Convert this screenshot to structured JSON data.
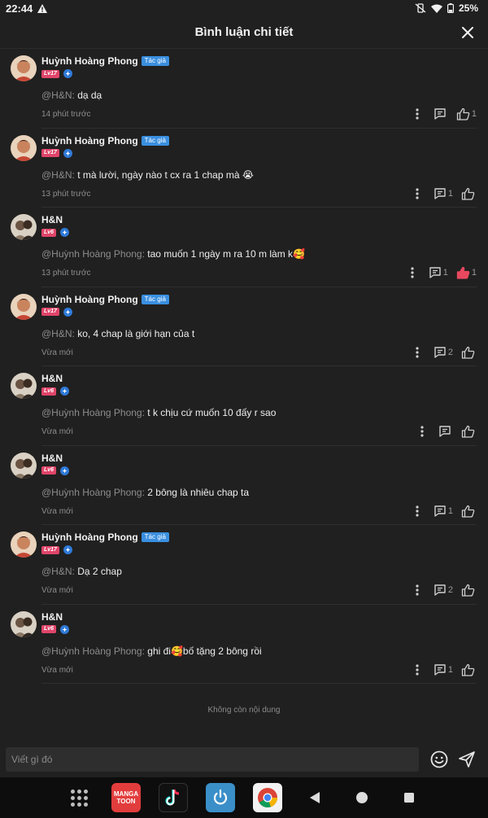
{
  "status_bar": {
    "time": "22:44",
    "battery": "25%"
  },
  "header": {
    "title": "Bình luận chi tiết"
  },
  "comments": [
    {
      "user": "Huỳnh Hoàng Phong",
      "is_author": true,
      "author_badge": "Tác giả",
      "level": "Lv17",
      "mention": "@H&N:",
      "body": "dạ dạ",
      "time": "14 phút trước",
      "reply_count": "",
      "like_count": "1",
      "liked": false
    },
    {
      "user": "Huỳnh Hoàng Phong",
      "is_author": true,
      "author_badge": "Tác giả",
      "level": "Lv17",
      "mention": "@H&N:",
      "body": "t mà lười, ngày nào t cx ra 1 chap mà 😭",
      "time": "13 phút trước",
      "reply_count": "1",
      "like_count": "",
      "liked": false
    },
    {
      "user": "H&N",
      "is_author": false,
      "author_badge": "",
      "level": "Lv6",
      "mention": "@Huỳnh Hoàng Phong:",
      "body": "tao muốn 1 ngày m ra 10 m làm k🥰",
      "time": "13 phút trước",
      "reply_count": "1",
      "like_count": "1",
      "liked": true
    },
    {
      "user": "Huỳnh Hoàng Phong",
      "is_author": true,
      "author_badge": "Tác giả",
      "level": "Lv17",
      "mention": "@H&N:",
      "body": "ko, 4 chap là giới hạn của t",
      "time": "Vừa mới",
      "reply_count": "2",
      "like_count": "",
      "liked": false
    },
    {
      "user": "H&N",
      "is_author": false,
      "author_badge": "",
      "level": "Lv6",
      "mention": "@Huỳnh Hoàng Phong:",
      "body": "t k chịu cứ muốn 10 đấy r sao",
      "time": "Vừa mới",
      "reply_count": "",
      "like_count": "",
      "liked": false
    },
    {
      "user": "H&N",
      "is_author": false,
      "author_badge": "",
      "level": "Lv6",
      "mention": "@Huỳnh Hoàng Phong:",
      "body": "2 bông là nhiêu chap ta",
      "time": "Vừa mới",
      "reply_count": "1",
      "like_count": "",
      "liked": false
    },
    {
      "user": "Huỳnh Hoàng Phong",
      "is_author": true,
      "author_badge": "Tác giả",
      "level": "Lv17",
      "mention": "@H&N:",
      "body": "Dạ 2 chap",
      "time": "Vừa mới",
      "reply_count": "2",
      "like_count": "",
      "liked": false
    },
    {
      "user": "H&N",
      "is_author": false,
      "author_badge": "",
      "level": "Lv6",
      "mention": "@Huỳnh Hoàng Phong:",
      "body": "ghi đi🥰bố tặng 2 bông rồi",
      "time": "Vừa mới",
      "reply_count": "1",
      "like_count": "",
      "liked": false
    }
  ],
  "end_note": "Không còn nội dung",
  "composer": {
    "placeholder": "Viết gì đó"
  },
  "nav": {
    "manga_line1": "MANGA",
    "manga_line2": "TOON"
  },
  "colors": {
    "like_active": "#e8495f",
    "author_badge": "#3a8fe0",
    "level_badge": "#e0456a"
  }
}
